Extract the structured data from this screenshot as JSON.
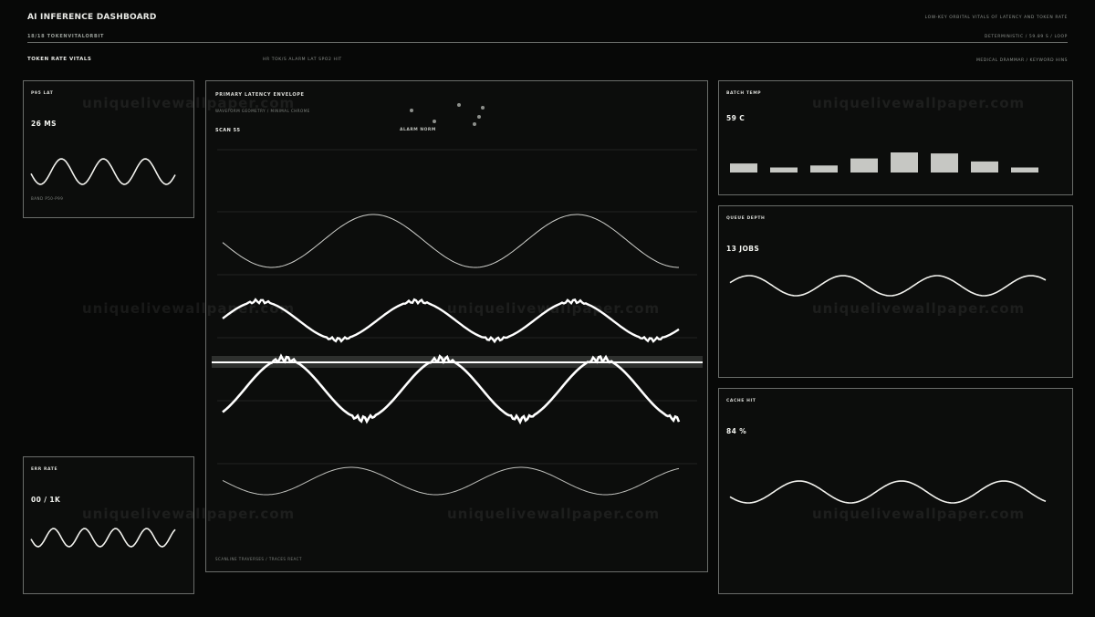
{
  "header": {
    "title": "AI INFERENCE DASHBOARD",
    "subtitle": "18/18  TOKENVITALORBIT",
    "right_top": "LOW-KEY ORBITAL VITALS OF LATENCY AND TOKEN RATE",
    "right_sub": "DETERMINISTIC / 59.89 S / LOOP"
  },
  "section": {
    "title": "TOKEN RATE VITALS",
    "meta": "HR  TOK/S  ALARM LAT  SPO2 HIT",
    "right": "MEDICAL DRAMMAR / KEYWORD HINS"
  },
  "panels": {
    "p95": {
      "label": "P95 LAT",
      "value": "26 MS",
      "foot": "BAND P50-P99"
    },
    "err": {
      "label": "ERR RATE",
      "value": "00 / 1K"
    },
    "batch": {
      "label": "BATCH TEMP",
      "value": "59 C",
      "bars": [
        0.45,
        0.25,
        0.35,
        0.7,
        1.0,
        0.95,
        0.55,
        0.25
      ]
    },
    "queue": {
      "label": "QUEUE DEPTH",
      "value": "13 JOBS"
    },
    "cache": {
      "label": "CACHE HIT",
      "value": "84 %"
    }
  },
  "main": {
    "title": "PRIMARY  LATENCY ENVELOPE",
    "subtitle": "WAVEFORM GEOMETRY  /  MINIMAL CHROME",
    "scan": "SCAN 55",
    "alarm": "ALARM  NORM",
    "foot": "SCANLINE TRAVERSES  /  TRACES REACT"
  },
  "watermark": "uniquelivewallpaper.com",
  "colors": {
    "background": "#070807",
    "panel": "#0c0d0c",
    "stroke": "#ffffff",
    "border": "#6a6d6a"
  }
}
